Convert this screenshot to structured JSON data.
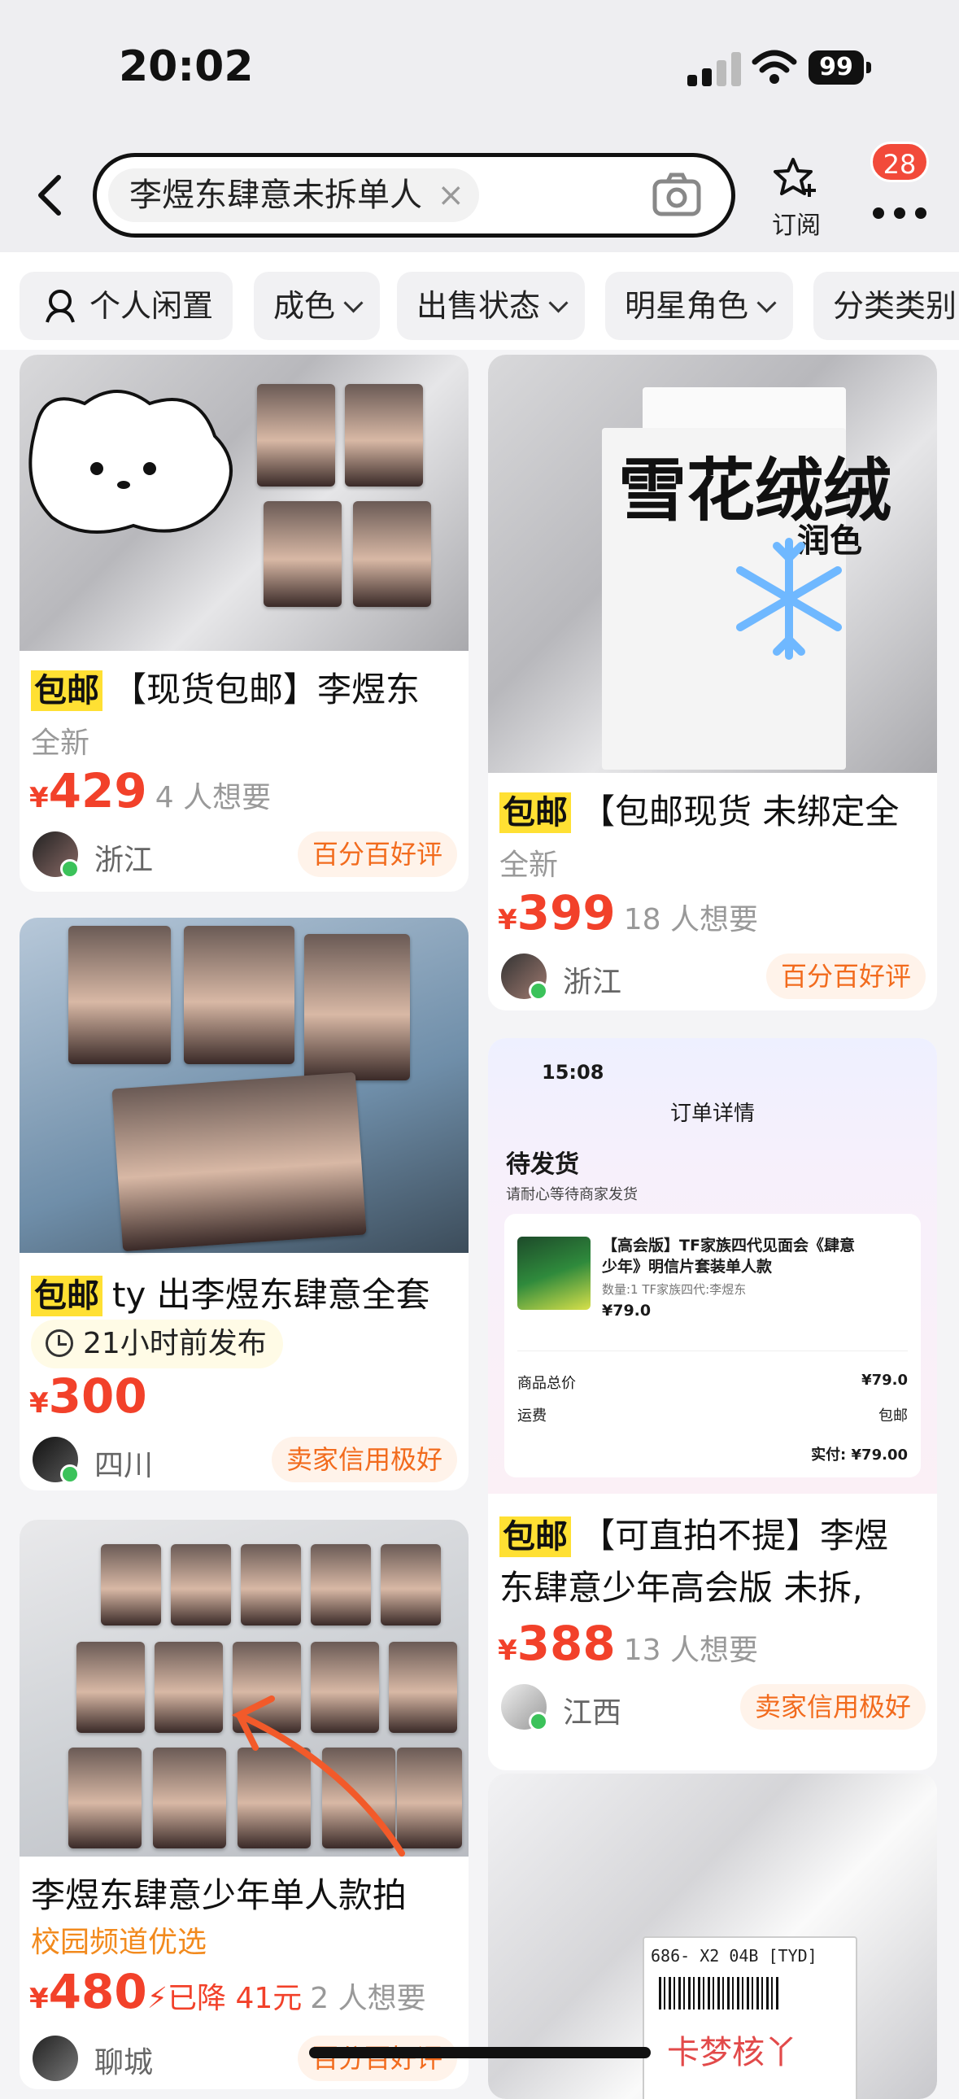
{
  "status_bar": {
    "time": "20:02",
    "battery": "99"
  },
  "header": {
    "search_query": "李煜东肆意未拆单人",
    "clear": "×",
    "subscribe_label": "订阅",
    "notification_count": "28"
  },
  "filters": [
    "个人闲置",
    "成色",
    "出售状态",
    "明星角色",
    "分类类别"
  ],
  "items": [
    {
      "tag": "包邮",
      "title": "【现货包邮】李煜东",
      "condition": "全新",
      "price": "429",
      "wants": "4 人想要",
      "location": "浙江",
      "reputation": "百分百好评"
    },
    {
      "tag": "包邮",
      "title": "【包邮现货 未绑定全",
      "condition": "全新",
      "price": "399",
      "wants": "18 人想要",
      "location": "浙江",
      "reputation": "百分百好评",
      "image_text": "雪花绒绒",
      "image_text2": "润色"
    },
    {
      "tag": "包邮",
      "title": "ty 出李煜东肆意全套",
      "published": "21小时前发布",
      "price": "300",
      "location": "四川",
      "reputation": "卖家信用极好"
    },
    {
      "tag": "包邮",
      "title": "【可直拍不提】李煜",
      "title_line2": "东肆意少年高会版 未拆,",
      "price": "388",
      "wants": "13 人想要",
      "location": "江西",
      "reputation": "卖家信用极好",
      "order": {
        "time": "15:08",
        "page_title": "订单详情",
        "status": "待发货",
        "subtitle": "请耐心等待商家发货",
        "product_name": "【高会版】TF家族四代见面会《肆意少年》明信片套装单人款",
        "product_qty": "数量:1 TF家族四代:李煜东",
        "product_price": "¥79.0",
        "total_label": "商品总价",
        "total_value": "¥79.0",
        "shipping_label": "运费",
        "shipping_value": "包邮",
        "paid": "实付: ¥79.00"
      }
    },
    {
      "title": "李煜东肆意少年单人款拍",
      "channel": "校园频道优选",
      "price": "480",
      "drop": "已降 41元",
      "wants": "2 人想要",
      "location": "聊城",
      "reputation": "百分百好评"
    },
    {
      "image_text": "卡梦核丫",
      "label_code": "686- X2 04B [TYD]"
    }
  ]
}
